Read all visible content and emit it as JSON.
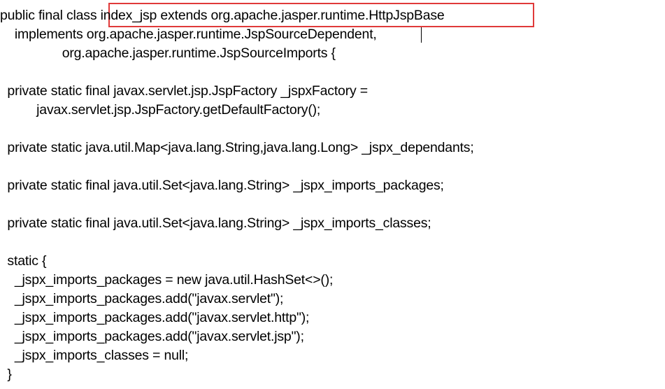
{
  "document": {
    "lines": [
      "public final class index_jsp extends org.apache.jasper.runtime.HttpJspBase",
      "    implements org.apache.jasper.runtime.JspSourceDependent,",
      "                 org.apache.jasper.runtime.JspSourceImports {",
      "",
      "  private static final javax.servlet.jsp.JspFactory _jspxFactory =",
      "          javax.servlet.jsp.JspFactory.getDefaultFactory();",
      "",
      "  private static java.util.Map<java.lang.String,java.lang.Long> _jspx_dependants;",
      "",
      "  private static final java.util.Set<java.lang.String> _jspx_imports_packages;",
      "",
      "  private static final java.util.Set<java.lang.String> _jspx_imports_classes;",
      "",
      "  static {",
      "    _jspx_imports_packages = new java.util.HashSet<>();",
      "    _jspx_imports_packages.add(\"javax.servlet\");",
      "    _jspx_imports_packages.add(\"javax.servlet.http\");",
      "    _jspx_imports_packages.add(\"javax.servlet.jsp\");",
      "    _jspx_imports_classes = null;",
      "  }"
    ],
    "highlight_color": "#e03a3a"
  }
}
